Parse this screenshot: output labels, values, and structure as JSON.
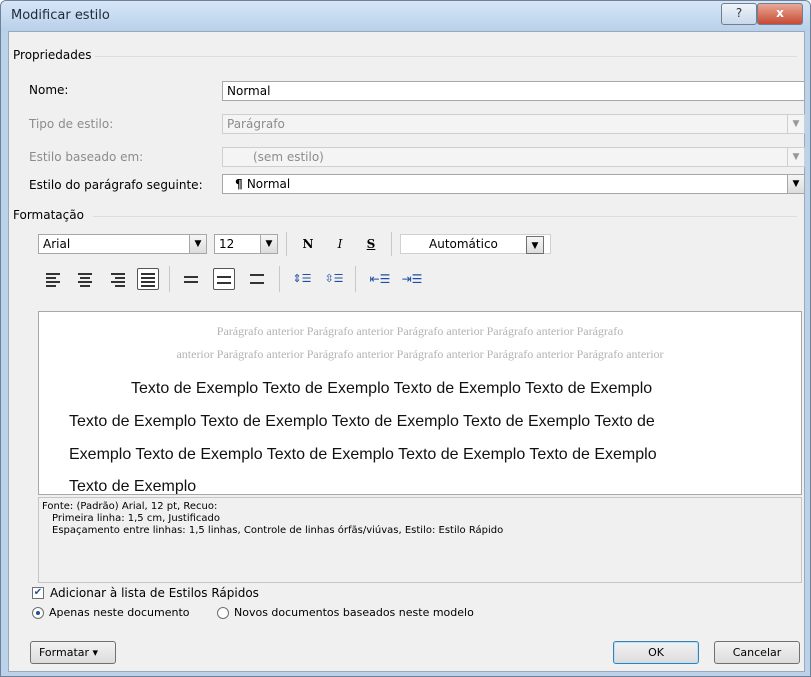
{
  "window": {
    "title": "Modificar estilo",
    "help_label": "?",
    "close_label": "x"
  },
  "properties": {
    "group_label": "Propriedades",
    "name_label": "Nome:",
    "name_value": "Normal",
    "type_label": "Tipo de estilo:",
    "type_value": "Parágrafo",
    "based_label": "Estilo baseado em:",
    "based_value": "(sem estilo)",
    "next_label": "Estilo do parágrafo seguinte:",
    "next_value": "Normal",
    "next_icon": "pilcrow-icon"
  },
  "formatting": {
    "group_label": "Formatação",
    "font": "Arial",
    "size": "12",
    "bold": "N",
    "italic": "I",
    "underline": "S",
    "color": "Automático"
  },
  "preview": {
    "previous_line1": "Parágrafo anterior Parágrafo anterior Parágrafo anterior Parágrafo anterior Parágrafo",
    "previous_line2": "anterior Parágrafo anterior Parágrafo anterior Parágrafo anterior Parágrafo anterior Parágrafo anterior",
    "sample_line1": "Texto de Exemplo Texto de Exemplo Texto de Exemplo Texto de Exemplo",
    "sample_line2": "Texto de Exemplo Texto de Exemplo Texto de Exemplo Texto de Exemplo Texto de",
    "sample_line3": "Exemplo Texto de Exemplo Texto de Exemplo Texto de Exemplo Texto de Exemplo",
    "sample_line4": "Texto de Exemplo"
  },
  "description": {
    "line1": "Fonte: (Padrão) Arial, 12 pt, Recuo:",
    "line2": "Primeira linha:  1,5 cm, Justificado",
    "line3": "Espaçamento entre linhas:  1,5 linhas, Controle de linhas órfãs/viúvas, Estilo: Estilo Rápido"
  },
  "options": {
    "add_quick_label": "Adicionar à lista de Estilos Rápidos",
    "add_quick_checked": true,
    "only_doc_label": "Apenas neste documento",
    "new_docs_label": "Novos documentos baseados neste modelo",
    "selected_option": "only_doc"
  },
  "buttons": {
    "format_label": "Formatar ▾",
    "ok_label": "OK",
    "cancel_label": "Cancelar"
  },
  "colors": {
    "title_bar": "#c4d8ef",
    "close": "#c74a34",
    "accent": "#1f4ea3"
  }
}
